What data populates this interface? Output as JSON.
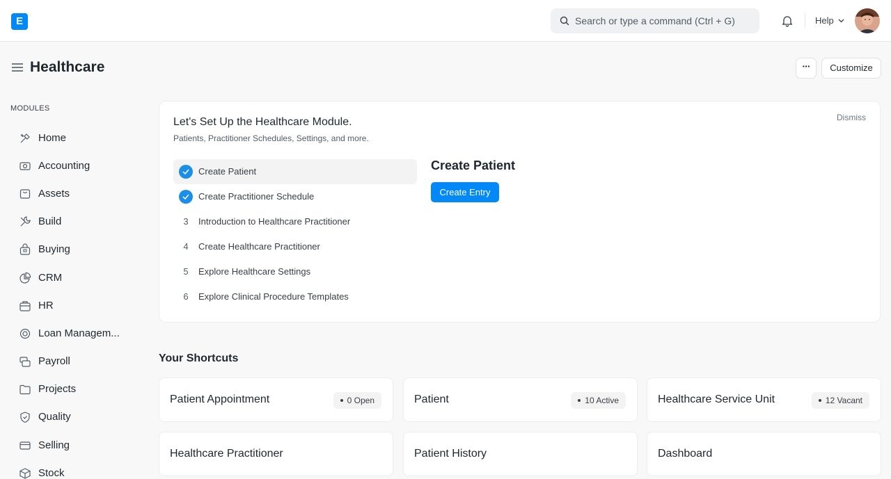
{
  "navbar": {
    "logo_letter": "E",
    "search_placeholder": "Search or type a command (Ctrl + G)",
    "help_label": "Help"
  },
  "header": {
    "title": "Healthcare",
    "customize_label": "Customize",
    "more_label": "···"
  },
  "sidebar": {
    "section_label": "MODULES",
    "items": [
      {
        "label": "Home",
        "icon": "tools-icon"
      },
      {
        "label": "Accounting",
        "icon": "money-icon"
      },
      {
        "label": "Assets",
        "icon": "box-icon"
      },
      {
        "label": "Build",
        "icon": "wrench-icon"
      },
      {
        "label": "Buying",
        "icon": "bag-icon"
      },
      {
        "label": "CRM",
        "icon": "pie-chart-icon"
      },
      {
        "label": "HR",
        "icon": "briefcase-icon"
      },
      {
        "label": "Loan Managem...",
        "icon": "coins-icon"
      },
      {
        "label": "Payroll",
        "icon": "stack-icon"
      },
      {
        "label": "Projects",
        "icon": "folder-icon"
      },
      {
        "label": "Quality",
        "icon": "shield-icon"
      },
      {
        "label": "Selling",
        "icon": "card-icon"
      },
      {
        "label": "Stock",
        "icon": "package-icon"
      }
    ]
  },
  "setup": {
    "title": "Let's Set Up the Healthcare Module.",
    "subtitle": "Patients, Practitioner Schedules, Settings, and more.",
    "dismiss_label": "Dismiss",
    "steps": [
      {
        "num": "1",
        "label": "Create Patient",
        "done": true
      },
      {
        "num": "2",
        "label": "Create Practitioner Schedule",
        "done": true
      },
      {
        "num": "3",
        "label": "Introduction to Healthcare Practitioner",
        "done": false
      },
      {
        "num": "4",
        "label": "Create Healthcare Practitioner",
        "done": false
      },
      {
        "num": "5",
        "label": "Explore Healthcare Settings",
        "done": false
      },
      {
        "num": "6",
        "label": "Explore Clinical Procedure Templates",
        "done": false
      }
    ],
    "detail_title": "Create Patient",
    "action_label": "Create Entry"
  },
  "shortcuts": {
    "title": "Your Shortcuts",
    "items": [
      {
        "label": "Patient Appointment",
        "pill": "0 Open"
      },
      {
        "label": "Patient",
        "pill": "10 Active"
      },
      {
        "label": "Healthcare Service Unit",
        "pill": "12 Vacant"
      },
      {
        "label": "Healthcare Practitioner",
        "pill": ""
      },
      {
        "label": "Patient History",
        "pill": ""
      },
      {
        "label": "Dashboard",
        "pill": ""
      }
    ]
  },
  "colors": {
    "accent": "#0289f7",
    "step_done": "#1b8fe8",
    "background": "#f8f8f8"
  }
}
